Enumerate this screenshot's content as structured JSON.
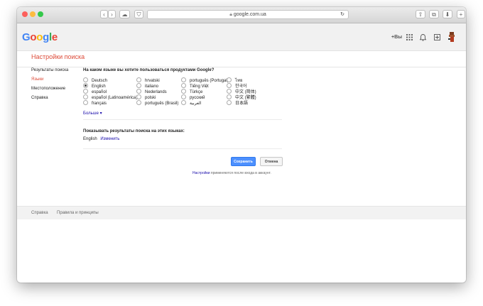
{
  "browser": {
    "url": "google.com.ua",
    "colors": {
      "close": "#fc605c",
      "minimize": "#fdbc40",
      "zoom": "#34c84a"
    },
    "buttons": {
      "back": "‹",
      "forward": "›",
      "cloud": "☁",
      "pocket": "⛉",
      "reload": "↻",
      "share": "⇧",
      "tabs": "⧉",
      "download": "⬇",
      "new_tab": "+"
    }
  },
  "header": {
    "logo": [
      "G",
      "o",
      "o",
      "g",
      "l",
      "e"
    ],
    "logo_colors": [
      "#4285f4",
      "#ea4335",
      "#fbbc05",
      "#4285f4",
      "#34a853",
      "#ea4335"
    ],
    "plus": "+Вы",
    "apps_icon": "⋮⋮",
    "bell_icon": "🔔",
    "share_icon": "⊞"
  },
  "page_title": "Настройки поиска",
  "sidebar": {
    "items": [
      {
        "label": "Результаты поиска",
        "active": false
      },
      {
        "label": "Языки",
        "active": true
      },
      {
        "label": "Местоположение",
        "active": false
      },
      {
        "label": "Справка",
        "active": false
      }
    ]
  },
  "language_section": {
    "question": "На каком языке вы хотите пользоваться продуктами Google?",
    "selected": "English",
    "columns": [
      [
        "Deutsch",
        "English",
        "español",
        "español (Latinoamérica)",
        "français"
      ],
      [
        "hrvatski",
        "italiano",
        "Nederlands",
        "polski",
        "português (Brasil)"
      ],
      [
        "português (Portugal)",
        "Tiếng Việt",
        "Türkçe",
        "русский",
        "العربية"
      ],
      [
        "ไทย",
        "한국어",
        "中文 (简体)",
        "中文 (繁體)",
        "日本語"
      ]
    ],
    "more": "Больше ▾"
  },
  "results_section": {
    "title": "Показывать результаты поиска на этих языках:",
    "value": "English",
    "change": "Изменить"
  },
  "actions": {
    "save": "Сохранить",
    "cancel": "Отмена"
  },
  "note": {
    "link": "Настройки",
    "text": " применяются после входа в аккаунт."
  },
  "footer": {
    "links": [
      "Справка",
      "Правила и принципы"
    ]
  }
}
